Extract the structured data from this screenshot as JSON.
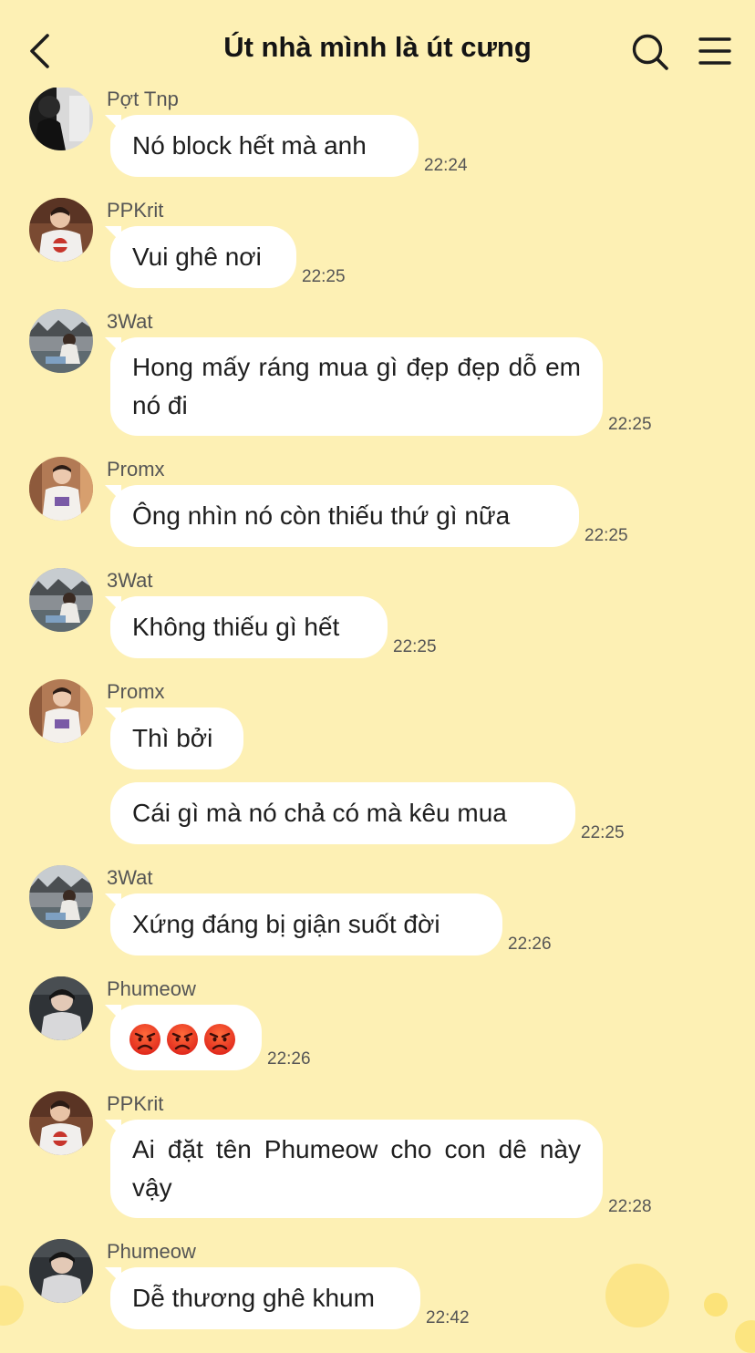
{
  "header": {
    "title": "Út nhà mình là út cưng",
    "back_icon": "chevron-left-icon",
    "search_icon": "search-icon",
    "menu_icon": "menu-icon"
  },
  "colors": {
    "background": "#fdf0b4",
    "bubble": "#ffffff",
    "meta_text": "#555555"
  },
  "messages": [
    {
      "sender": "Pợt Tnp",
      "text": "Nó block hết mà anh",
      "time": "22:24"
    },
    {
      "sender": "PPKrit",
      "text": "Vui ghê nơi",
      "time": "22:25"
    },
    {
      "sender": "3Wat",
      "text": "Hong mấy ráng mua gì đẹp đẹp dỗ em nó đi",
      "time": "22:25"
    },
    {
      "sender": "Promx",
      "text": "Ông nhìn nó còn thiếu thứ gì nữa",
      "time": "22:25"
    },
    {
      "sender": "3Wat",
      "text": "Không thiếu gì hết",
      "time": "22:25"
    },
    {
      "sender": "Promx",
      "text": "Thì bởi",
      "time": ""
    },
    {
      "sender": "",
      "text": "Cái gì mà nó chả có mà kêu mua",
      "time": "22:25"
    },
    {
      "sender": "3Wat",
      "text": "Xứng đáng bị giận suốt đời",
      "time": "22:26"
    },
    {
      "sender": "Phumeow",
      "text": "",
      "emoji": [
        "angry-face",
        "angry-face",
        "angry-face"
      ],
      "time": "22:26"
    },
    {
      "sender": "PPKrit",
      "text": "Ai đặt tên Phumeow cho con dê này vậy",
      "time": "22:28"
    },
    {
      "sender": "Phumeow",
      "text": "Dễ thương ghê khum",
      "time": "22:42"
    }
  ]
}
